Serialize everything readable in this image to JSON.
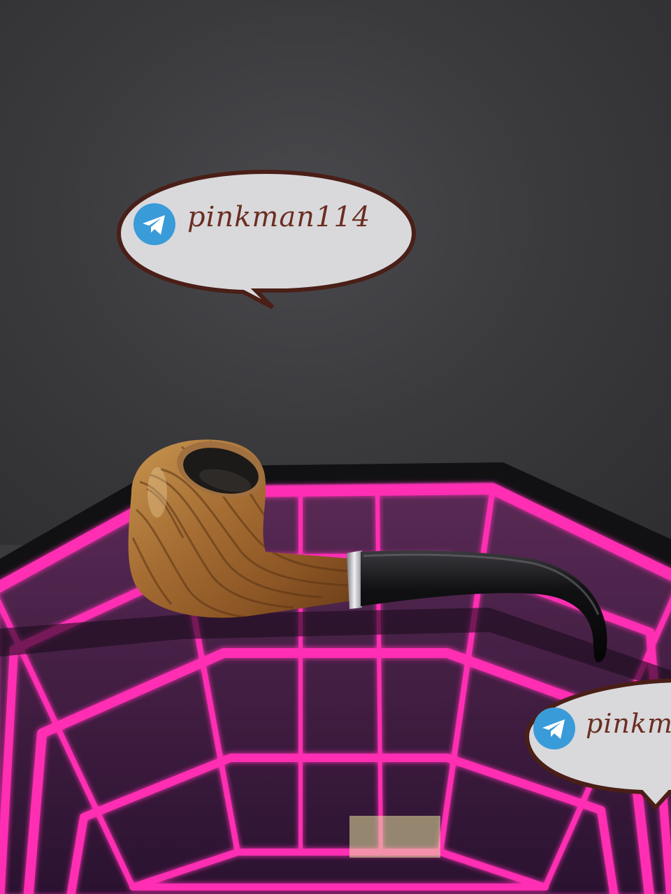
{
  "scene": {
    "subject": "tobacco-pipe",
    "colors": {
      "wall": "#3a3a3c",
      "neon": "#ff2fb3",
      "wood": "#b07a3a",
      "stem": "#0d0d0f",
      "bubble": "#d9d9dc",
      "bubble_border": "#4a1f17",
      "text": "#6b2e22",
      "telegram": "#3a9bd9"
    }
  },
  "watermarks": [
    {
      "icon": "telegram-icon",
      "handle": "pinkman114"
    },
    {
      "icon": "telegram-icon",
      "handle": "pinkm"
    }
  ]
}
